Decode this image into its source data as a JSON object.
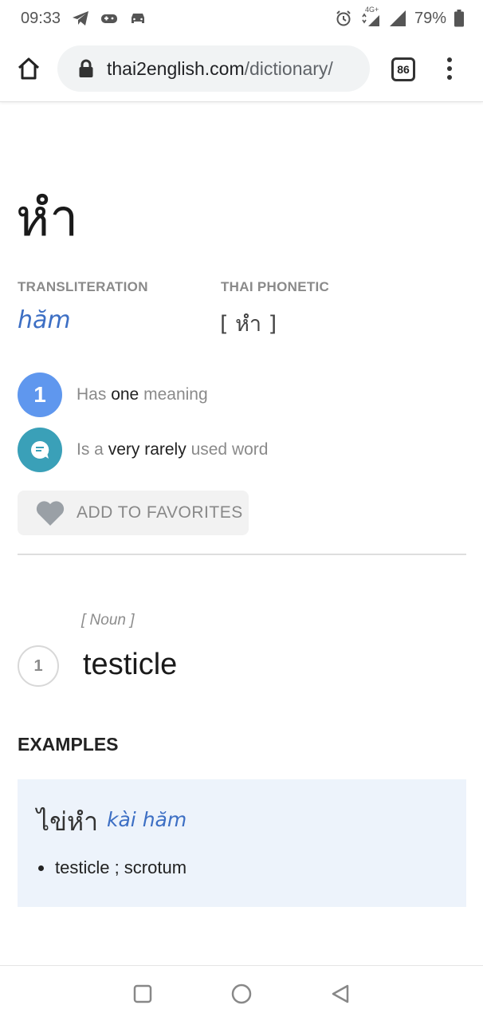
{
  "status_bar": {
    "time": "09:33",
    "network": "4G+",
    "battery": "79%"
  },
  "browser": {
    "url_host": "thai2english.com",
    "url_path": "/dictionary/",
    "tab_count": "86"
  },
  "entry": {
    "headword": "หำ",
    "transliteration_label": "TRANSLITERATION",
    "transliteration": "hăm",
    "phonetic_label": "THAI PHONETIC",
    "phonetic": "[ หำ ]"
  },
  "info": {
    "meanings_count": "1",
    "meanings_prefix": "Has",
    "meanings_emph": "one",
    "meanings_suffix": "meaning",
    "usage_prefix": "Is a",
    "usage_emph": "very rarely",
    "usage_suffix": "used word"
  },
  "favorites": {
    "label": "ADD TO FAVORITES"
  },
  "sense": {
    "part_of_speech": "[ Noun ]",
    "number": "1",
    "meaning": "testicle"
  },
  "examples": {
    "heading": "EXAMPLES",
    "items": [
      {
        "thai": "ไข่หำ",
        "transliteration": "kài hăm",
        "meaning": "testicle ; scrotum"
      }
    ]
  },
  "colors": {
    "link_blue": "#3d6fc4",
    "count_badge": "#5f97ee",
    "usage_badge": "#3aa0b8",
    "example_bg": "#edf3fb"
  },
  "icons": [
    "telegram-icon",
    "gamepad-icon",
    "car-icon",
    "alarm-icon",
    "signal-icon",
    "battery-icon",
    "home-icon",
    "lock-icon",
    "menu-icon",
    "chat-icon",
    "heart-icon",
    "square-icon",
    "circle-icon",
    "back-triangle-icon"
  ]
}
